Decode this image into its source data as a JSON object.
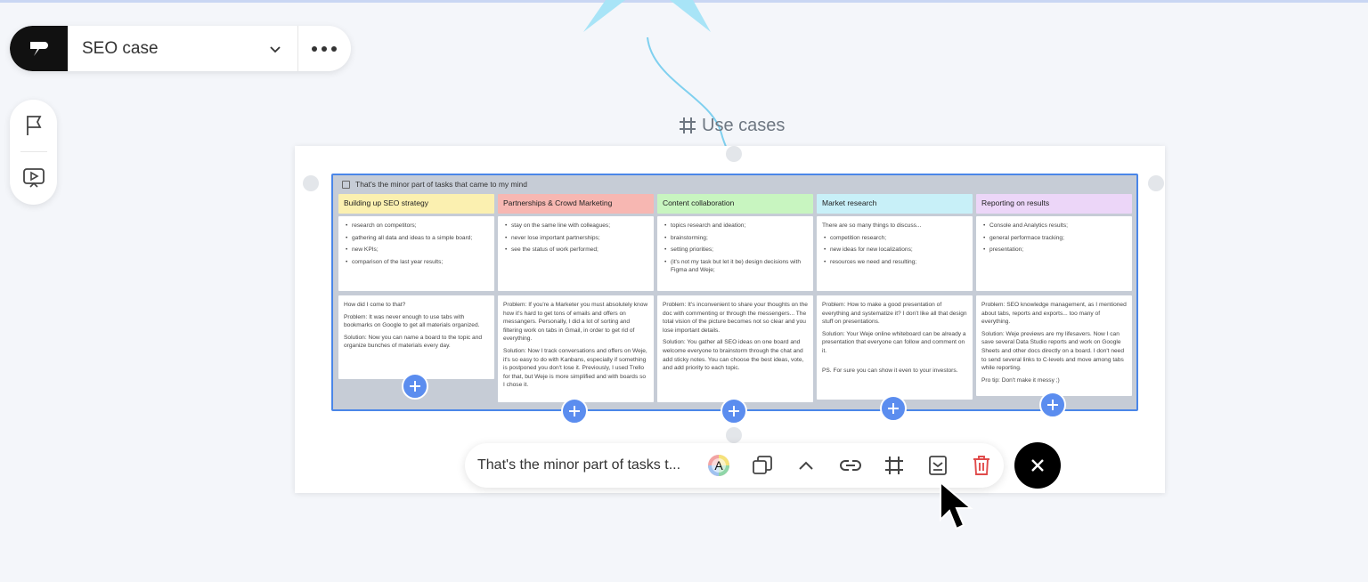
{
  "project": {
    "name": "SEO case"
  },
  "frame": {
    "label": "Use cases"
  },
  "kanban": {
    "title": "That's the minor part of tasks that came to my mind",
    "columns": [
      {
        "title": "Building up SEO strategy",
        "color": "#fbf0b0",
        "bullets": [
          "research on competitors;",
          "gathering all data and ideas to a simple board;",
          "new KPIs;",
          "comparison of the last year results;"
        ],
        "paras": [
          "How did I come to that?",
          "Problem: It was never enough to use tabs with bookmarks on Google to get all materials organized.",
          "Solution: Now you can name a board to the topic and organize bunches of materials every day."
        ]
      },
      {
        "title": "Partnerships & Crowd Marketing",
        "color": "#f7b7b2",
        "bullets": [
          "stay on the same line with colleagues;",
          "never lose important partnerships;",
          "see the status of work performed;"
        ],
        "paras": [
          "Problem: If you're a Marketer you must absolutely know how it's hard to get tons of emails and offers on messangers. Personally, I did a lot of sorting and filtering work on tabs in Gmail, in order to get rid of everything.",
          "Solution: Now I track conversations and offers on Weje, it's so easy to do with Kanbans, especially if something is postponed you don't lose it. Previously, I used Trello for that, but Weje is more simplified and with boards so I chose it."
        ]
      },
      {
        "title": "Content collaboration",
        "color": "#c8f5c0",
        "bullets": [
          "topics research and ideation;",
          "brainstorming;",
          "setting priorities;",
          "(it's not my task but let it be) design decisions with Figma and Weje;"
        ],
        "paras": [
          "Problem: It's inconvenient to share your thoughts on the doc with commenting or through the messengers... The total vision of the picture becomes not so clear and you lose important details.",
          "Solution: You gather all SEO ideas on one board and welcome everyone to brainstorm through the chat and add sticky notes. You can choose the best ideas, vote, and add priority to each topic."
        ]
      },
      {
        "title": "Market research",
        "color": "#c8f0f8",
        "intro": "There are so many things to discuss...",
        "bullets": [
          "competition research;",
          "new ideas for new localizations;",
          "resources we need and resulting;"
        ],
        "paras": [
          "Problem: How to make a good presentation of everything and systematize it? I don't like all that design stuff on presentations.",
          "Solution: Your Weje online whiteboard can be already a presentation that everyone can follow and comment on it.",
          "PS. For sure you can show it even to your investors."
        ]
      },
      {
        "title": "Reporting on results",
        "color": "#ecd6f8",
        "bullets": [
          "Console and Analytics results;",
          "general performace tracking;",
          "presentation;"
        ],
        "paras": [
          "Problem: SEO knowledge management, as I mentioned about tabs, reports and exports... too many of everything.",
          "Solution: Weje previews are my lifesavers. Now I can save several Data Studio reports and work on Google Sheets and other docs directly on a board. I don't need to send several links to C-levels and move among tabs while reporting.",
          "Pro tip: Don't make it messy ;)"
        ]
      }
    ]
  },
  "toolbar": {
    "text": "That's the minor part of tasks  t...",
    "color_letter": "A"
  }
}
